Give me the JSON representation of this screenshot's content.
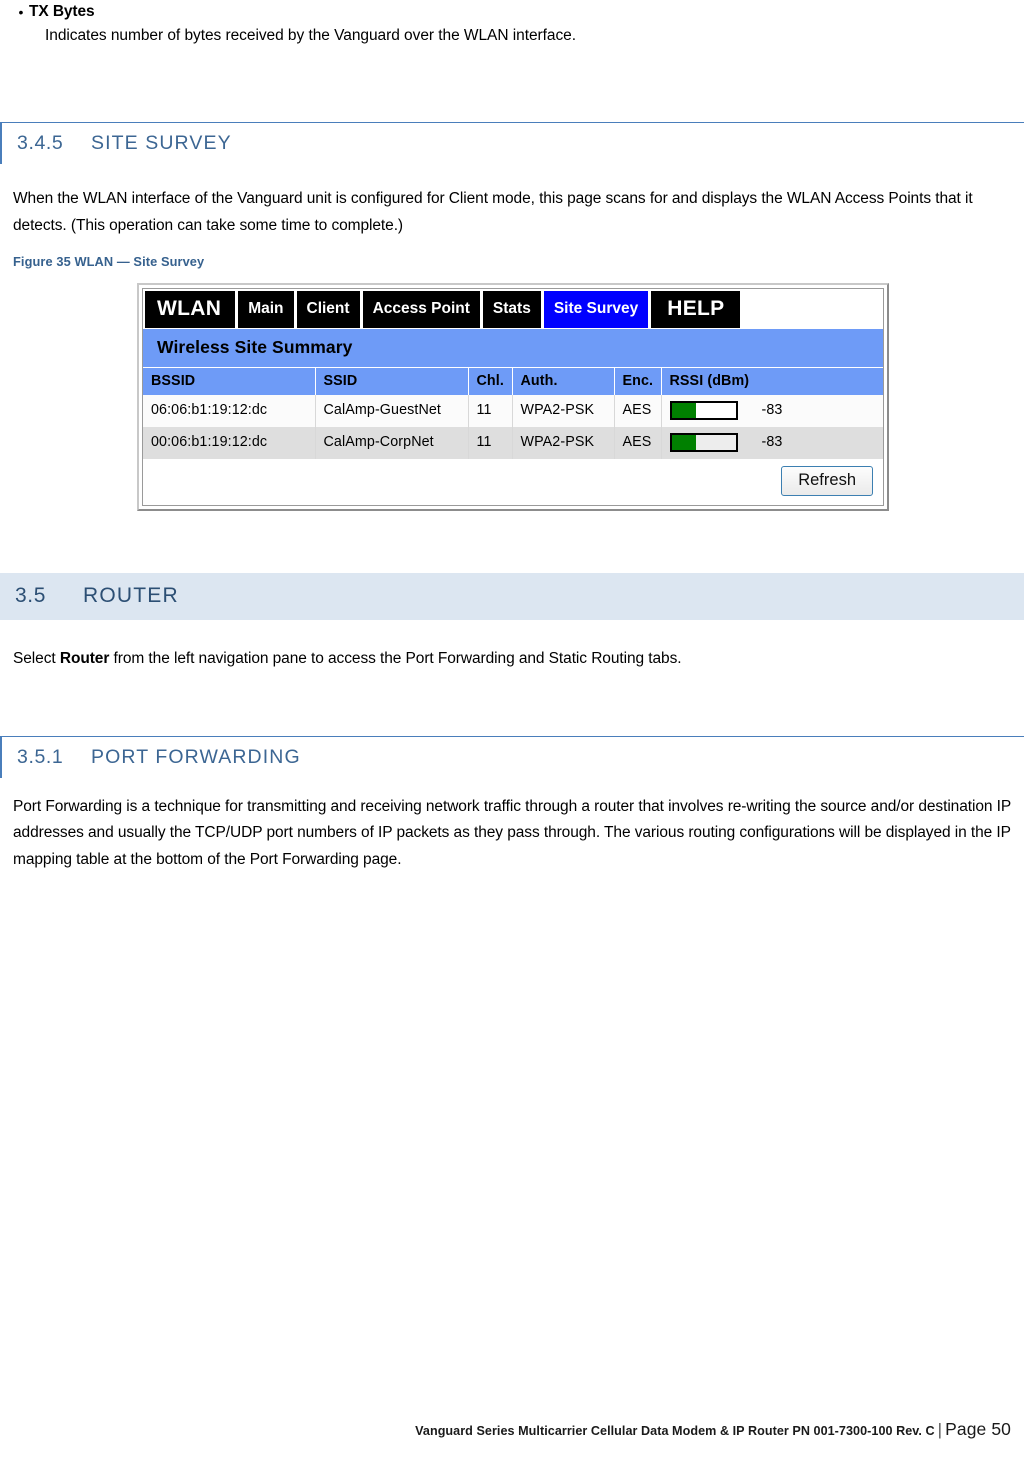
{
  "bullet": {
    "term": "TX Bytes",
    "marker": "•",
    "description": "Indicates number of bytes received by the Vanguard over the WLAN interface."
  },
  "sections": [
    {
      "number": "3.4.5",
      "title": "SITE SURVEY",
      "body": "When the WLAN interface of the Vanguard unit is configured for Client mode, this page scans for and displays the WLAN Access Points that it detects. (This operation can take some time to complete.)"
    },
    {
      "number": "3.5",
      "title": "ROUTER",
      "body_prefix": "Select ",
      "body_bold": "Router",
      "body_suffix": " from the left navigation pane to access the Port Forwarding and Static Routing tabs."
    },
    {
      "number": "3.5.1",
      "title": "PORT FORWARDING",
      "body": "Port Forwarding is a technique for transmitting and receiving network traffic through a router that involves re-writing the source and/or destination IP addresses and usually the TCP/UDP port numbers of IP packets as they pass through. The various routing configurations will be displayed in the IP mapping table at the bottom of the Port Forwarding page."
    }
  ],
  "figure": {
    "caption": "Figure 35 WLAN — Site Survey",
    "screenshot": {
      "tabs": [
        {
          "label": "WLAN",
          "active": false,
          "brand": true
        },
        {
          "label": "Main",
          "active": false,
          "brand": false
        },
        {
          "label": "Client",
          "active": false,
          "brand": false
        },
        {
          "label": "Access Point",
          "active": false,
          "brand": false
        },
        {
          "label": "Stats",
          "active": false,
          "brand": false
        },
        {
          "label": "Site Survey",
          "active": true,
          "brand": false
        },
        {
          "label": "HELP",
          "active": false,
          "brand": false
        }
      ],
      "summary_title": "Wireless Site Summary",
      "columns": [
        "BSSID",
        "SSID",
        "Chl.",
        "Auth.",
        "Enc.",
        "RSSI (dBm)"
      ],
      "rows": [
        {
          "bssid": "06:06:b1:19:12:dc",
          "ssid": "CalAmp-GuestNet",
          "chl": "11",
          "auth": "WPA2-PSK",
          "enc": "AES",
          "rssi": "-83",
          "rssi_fill_percent": 38
        },
        {
          "bssid": "00:06:b1:19:12:dc",
          "ssid": "CalAmp-CorpNet",
          "chl": "11",
          "auth": "WPA2-PSK",
          "enc": "AES",
          "rssi": "-83",
          "rssi_fill_percent": 38
        }
      ],
      "refresh_label": "Refresh",
      "colors": {
        "tab_background": "#000000",
        "tab_active": "#0000ff",
        "table_header": "#6e9bf7",
        "rssi_fill": "#008000",
        "row_alt": "#dedede"
      }
    }
  },
  "footer": {
    "text": "Vanguard Series Multicarrier Cellular Data Modem & IP Router PN 001-7300-100 Rev. C",
    "separator": "|",
    "page": "Page 50"
  },
  "theme": {
    "heading_accent": "#4a7ebb",
    "heading_text": "#3c6693",
    "heading2_band": "#dce6f1",
    "caption_color": "#36618e"
  }
}
